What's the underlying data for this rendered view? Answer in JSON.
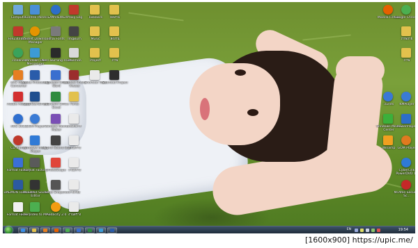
{
  "caption": {
    "resolution": "[1600x900]",
    "url": "https://upic.me/"
  },
  "desktop": {
    "columns": [
      {
        "icons": [
          {
            "label": "Computer",
            "icon": "computer-icon",
            "color": "#6fa8dc"
          },
          {
            "label": "FileZilla 3.5.3",
            "icon": "filezilla-icon",
            "color": "#c0392b"
          },
          {
            "label": "ccleaner",
            "icon": "ccleaner-icon",
            "color": "#3aa35b"
          },
          {
            "label": "AVS Video Converter",
            "icon": "video-icon",
            "color": "#e67e22"
          },
          {
            "label": "Adobe Acrobat",
            "icon": "acrobat-icon",
            "color": "#d32f2f"
          },
          {
            "label": "AVG 2013",
            "icon": "avg-icon",
            "color": "#2f6fcf"
          },
          {
            "label": "CD Burner",
            "icon": "disc-icon",
            "color": "#c0392b"
          },
          {
            "label": "Format Factory",
            "icon": "format-icon",
            "color": "#3b6fd6"
          },
          {
            "label": "DAEMON Tools Lite",
            "icon": "daemon-icon",
            "color": "#2c5aa0"
          },
          {
            "label": "Format Factory",
            "icon": "format-icon",
            "color": "#f0f0f0"
          }
        ]
      },
      {
        "icons": [
          {
            "label": "Control Panel",
            "icon": "control-panel-icon",
            "color": "#4a8fd6"
          },
          {
            "label": "Internet Download Manager",
            "icon": "idm-icon",
            "color": "#e59400"
          },
          {
            "label": "Windows Live Messenger",
            "icon": "messenger-icon",
            "color": "#3c9bd6"
          },
          {
            "label": "Adobe Photoshop",
            "icon": "photoshop-icon",
            "color": "#2a5caa"
          },
          {
            "label": "Nero StartSmart",
            "icon": "nero-icon",
            "color": "#1f4f8f"
          },
          {
            "label": "GOM Player",
            "icon": "gom-icon",
            "color": "#3a7bd5"
          },
          {
            "label": "Windows Media Player",
            "icon": "wmp-icon",
            "color": "#2f7ad6"
          },
          {
            "label": "Format Factory",
            "icon": "format-icon",
            "color": "#5a5a5a"
          },
          {
            "label": "WavePad Sound Editor",
            "icon": "wavepad-icon",
            "color": "#333333"
          },
          {
            "label": "Free Video to MP3",
            "icon": "mp3-icon",
            "color": "#4caf50"
          }
        ]
      },
      {
        "icons": [
          {
            "label": "TEAMVIEWER",
            "icon": "teamviewer-icon",
            "color": "#2d6ec8"
          },
          {
            "label": "Thai Fonts",
            "icon": "font-icon",
            "color": "#7a7a7a"
          },
          {
            "label": "Nero Burning ROM",
            "icon": "nero-icon",
            "color": "#2a2a2a"
          },
          {
            "label": "Microsoft Office Word",
            "icon": "word-icon",
            "color": "#3a6fcf"
          },
          {
            "label": "Microsoft Office Excel",
            "icon": "excel-icon",
            "color": "#2e8b3e"
          },
          {
            "label": "Window Movie Maker",
            "icon": "movie-maker-icon",
            "color": "#7a4fb5"
          },
          {
            "label": "Hybrid Sound Box",
            "icon": "sound-icon",
            "color": "#444444"
          },
          {
            "label": "PhotoScape",
            "icon": "photoscape-icon",
            "color": "#e0453a"
          },
          {
            "label": "Video Snapshot",
            "icon": "video-icon",
            "color": "#555555"
          },
          {
            "label": "Audacity 2.0",
            "icon": "audacity-icon",
            "color": "#f39c12"
          }
        ]
      },
      {
        "icons": [
          {
            "label": "Proxy Leg",
            "icon": "proxy-icon",
            "color": "#c0392b"
          },
          {
            "label": "ImgBurn",
            "icon": "imgburn-icon",
            "color": "#444444"
          },
          {
            "label": "Daemon",
            "icon": "daemon-icon",
            "color": "#d9d9d9"
          },
          {
            "label": "Window Photo Viewer",
            "icon": "photo-icon",
            "color": "#9b2d2d"
          },
          {
            "label": "Fonts",
            "icon": "folder-icon",
            "color": "#e2c14d"
          },
          {
            "label": "คนส่งสาร",
            "icon": "file-icon",
            "color": "#eaeaea"
          },
          {
            "label": "งานสร้าง",
            "icon": "file-icon",
            "color": "#eaeaea"
          },
          {
            "label": "งานสร้าง",
            "icon": "file-icon",
            "color": "#eaeaea"
          },
          {
            "label": "งานวิจัย",
            "icon": "file-icon",
            "color": "#eaeaea"
          },
          {
            "label": "งานสร้าง",
            "icon": "file-icon",
            "color": "#eaeaea"
          }
        ]
      },
      {
        "icons": [
          {
            "label": "Taskbars",
            "icon": "folder-icon",
            "color": "#e2c14d"
          },
          {
            "label": "Music",
            "icon": "folder-icon",
            "color": "#e2c14d"
          },
          {
            "label": "Project",
            "icon": "folder-icon",
            "color": "#e2c14d"
          },
          {
            "label": "Shortcut ให้ส่ง",
            "icon": "file-icon",
            "color": "#eaeaea"
          }
        ]
      },
      {
        "icons": [
          {
            "label": "ผลงาน",
            "icon": "folder-icon",
            "color": "#e2c14d"
          },
          {
            "label": "ส่งงาน",
            "icon": "folder-icon",
            "color": "#e2c14d"
          },
          {
            "label": "ภาพ",
            "icon": "folder-icon",
            "color": "#e2c14d"
          },
          {
            "label": "Shortcut Project",
            "icon": "file-icon",
            "color": "#2e2e2e"
          }
        ]
      }
    ],
    "right_icons": [
      {
        "label": "Mozilla Firefox",
        "icon": "firefox-icon",
        "color": "#e66000",
        "col": 0,
        "row": 0
      },
      {
        "label": "Google Chrome",
        "icon": "chrome-icon",
        "color": "#4caf50",
        "col": 1,
        "row": 0
      },
      {
        "label": "ภาพถ่าย",
        "icon": "folder-icon",
        "color": "#e2c14d",
        "col": 1,
        "row": 1
      },
      {
        "label": "ภาพ",
        "icon": "folder-icon",
        "color": "#e2c14d",
        "col": 1,
        "row": 2
      },
      {
        "label": "iTunes",
        "icon": "itunes-icon",
        "color": "#3a78d6",
        "col": 0,
        "row": 4
      },
      {
        "label": "KMPlayer",
        "icon": "kmplayer-icon",
        "color": "#3a7bd5",
        "col": 1,
        "row": 4
      },
      {
        "label": "Windows Media Center",
        "icon": "wmc-icon",
        "color": "#3bb03b",
        "col": 0,
        "row": 5
      },
      {
        "label": "PowerPlayer",
        "icon": "powerplayer-icon",
        "color": "#2d6ec8",
        "col": 1,
        "row": 5
      },
      {
        "label": "Winamp",
        "icon": "winamp-icon",
        "color": "#f0a020",
        "col": 0,
        "row": 6
      },
      {
        "label": "GOM Player",
        "icon": "gom-icon",
        "color": "#e07a1f",
        "col": 1,
        "row": 6
      },
      {
        "label": "CyberLink PowerDVD 11",
        "icon": "powerdvd-icon",
        "color": "#2f7ad6",
        "col": 1,
        "row": 7
      },
      {
        "label": "McAfee Security Sc...",
        "icon": "mcafee-icon",
        "color": "#c62828",
        "col": 1,
        "row": 8
      }
    ]
  },
  "taskbar": {
    "start_label": "Start",
    "pinned": [
      {
        "name": "ie",
        "icon": "internet-explorer-icon",
        "color": "#3a8ee6"
      },
      {
        "name": "explorer",
        "icon": "folder-icon",
        "color": "#e2c14d"
      },
      {
        "name": "media",
        "icon": "media-player-icon",
        "color": "#e67e22"
      },
      {
        "name": "firefox",
        "icon": "firefox-icon",
        "color": "#e66000"
      },
      {
        "name": "chrome",
        "icon": "chrome-icon",
        "color": "#4caf50"
      },
      {
        "name": "word",
        "icon": "word-icon",
        "color": "#3a6fcf"
      },
      {
        "name": "excel",
        "icon": "excel-icon",
        "color": "#2e8b3e"
      },
      {
        "name": "messenger",
        "icon": "messenger-icon",
        "color": "#3c9bd6"
      },
      {
        "name": "photoshop",
        "icon": "photoshop-icon",
        "color": "#2a5caa"
      }
    ],
    "language": "EN",
    "clock": "19:54"
  }
}
